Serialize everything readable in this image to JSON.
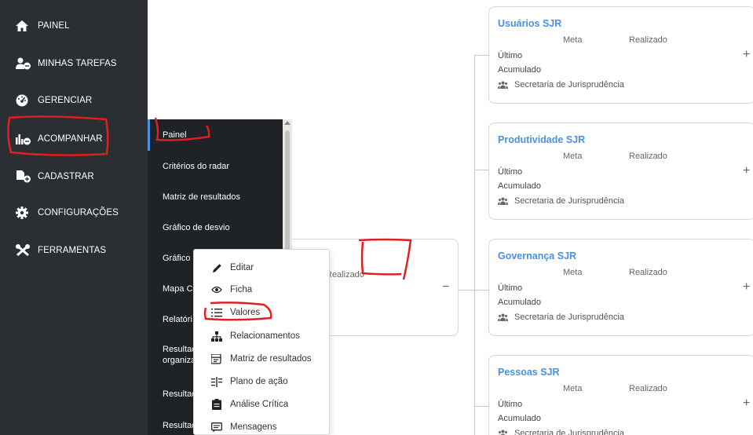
{
  "sidebar": {
    "items": [
      {
        "label": "PAINEL",
        "icon": "home-icon"
      },
      {
        "label": "MINHAS TAREFAS",
        "icon": "user-tasks-icon"
      },
      {
        "label": "GERENCIAR",
        "icon": "dashboard-gauge-icon"
      },
      {
        "label": "ACOMPANHAR",
        "icon": "chart-tracking-icon"
      },
      {
        "label": "CADASTRAR",
        "icon": "file-add-icon"
      },
      {
        "label": "CONFIGURAÇÕES",
        "icon": "cog-icon"
      },
      {
        "label": "FERRAMENTAS",
        "icon": "tools-icon"
      }
    ]
  },
  "submenu": {
    "items": [
      {
        "label": "Painel"
      },
      {
        "label": "Critérios do radar"
      },
      {
        "label": "Matriz de resultados"
      },
      {
        "label": "Gráfico de desvio"
      },
      {
        "label": "Gráfico"
      },
      {
        "label": "Mapa C"
      },
      {
        "label": "Relatóri"
      },
      {
        "label": "Resultad organiza"
      },
      {
        "label": "Resultad"
      },
      {
        "label": "Resultad"
      }
    ]
  },
  "center_node": {
    "realizado_label": "Realizado",
    "collapse_symbol": "−"
  },
  "cards": [
    {
      "title": "Usuários SJR",
      "meta": "Meta",
      "realizado": "Realizado",
      "ultimo": "Último",
      "acumulado": "Acumulado",
      "secretaria": "Secretaria de Jurisprudência",
      "plus": "+"
    },
    {
      "title": "Produtividade SJR",
      "meta": "Meta",
      "realizado": "Realizado",
      "ultimo": "Último",
      "acumulado": "Acumulado",
      "secretaria": "Secretaria de Jurisprudência",
      "plus": "+"
    },
    {
      "title": "Governança SJR",
      "meta": "Meta",
      "realizado": "Realizado",
      "ultimo": "Último",
      "acumulado": "Acumulado",
      "secretaria": "Secretaria de Jurisprudência",
      "plus": "+"
    },
    {
      "title": "Pessoas SJR",
      "meta": "Meta",
      "realizado": "Realizado",
      "ultimo": "Último",
      "acumulado": "Acumulado",
      "secretaria": "Secretaria de Jurisprudência",
      "plus": "+"
    }
  ],
  "context_menu": {
    "items": [
      {
        "label": "Editar",
        "icon": "pencil-icon"
      },
      {
        "label": "Ficha",
        "icon": "eye-icon"
      },
      {
        "label": "Valores",
        "icon": "list-icon"
      },
      {
        "label": "Relacionamentos",
        "icon": "sitemap-icon"
      },
      {
        "label": "Matriz de resultados",
        "icon": "matrix-icon"
      },
      {
        "label": "Plano de ação",
        "icon": "tasks-icon"
      },
      {
        "label": "Análise Crítica",
        "icon": "clipboard-icon"
      },
      {
        "label": "Mensagens",
        "icon": "message-icon"
      }
    ]
  },
  "colors": {
    "sidebar_bg": "#2b2f33",
    "submenu_bg": "#1f2226",
    "accent": "#4a90e2",
    "annotation": "#e02020"
  }
}
